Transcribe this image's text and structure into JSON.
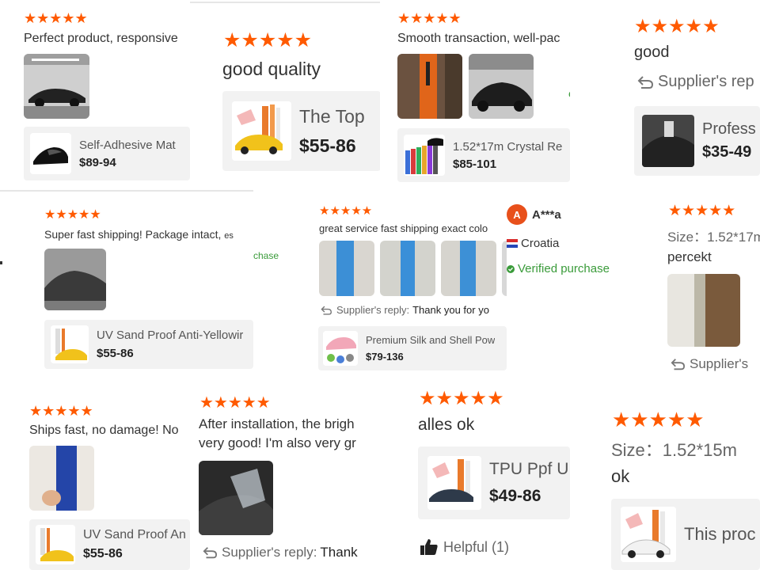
{
  "colors": {
    "star": "#ff5a00",
    "verified": "#3a9b3a",
    "card_bg": "#f2f2f2",
    "avatar": "#e8501b"
  },
  "icons": {
    "star": "★",
    "reply": "reply-arrow-icon",
    "verified": "check-badge-icon",
    "helpful": "thumbs-up-icon"
  },
  "reviews": {
    "r1": {
      "stars": "★★★★★",
      "text": "Perfect product, responsive",
      "product": {
        "name": "Self-Adhesive Mat",
        "price": "$89-94"
      }
    },
    "r2": {
      "stars": "★★★★★",
      "text": "good quality",
      "product": {
        "name": "The Top",
        "price": "$55-86"
      }
    },
    "r3": {
      "stars": "★★★★★",
      "text": "Smooth transaction, well-pac",
      "side": "e",
      "product": {
        "name": "1.52*17m Crystal Re",
        "price": "$85-101"
      }
    },
    "r4": {
      "stars": "★★★★★",
      "text": "good",
      "reply": "Supplier's rep",
      "product": {
        "name": "Profess",
        "price": "$35-49"
      }
    },
    "r5": {
      "stars": "★★★★★",
      "text": "Super fast shipping! Package intact,",
      "text_cut": "es",
      "side": "chase",
      "product": {
        "name": "UV Sand Proof Anti-Yellowir",
        "price": "$55-86"
      }
    },
    "r6": {
      "stars": "★★★★★",
      "text": "great service fast shipping exact colo",
      "reply_label": "Supplier's reply:",
      "reply_text": "Thank you for yo",
      "product": {
        "name": "Premium Silk and Shell Pow",
        "price": "$79-136"
      }
    },
    "r7": {
      "avatar": "A",
      "user": "A***a",
      "country": "Croatia",
      "verified": "Verified purchase"
    },
    "r8": {
      "stars": "★★★★★",
      "size": "Size：1.52*17m",
      "text": "percekt",
      "reply": "Supplier's"
    },
    "r9": {
      "stars": "★★★★★",
      "text": "Ships fast, no damage! No",
      "product": {
        "name": "UV Sand Proof An",
        "price": "$55-86"
      }
    },
    "r10": {
      "stars": "★★★★★",
      "line1": "After installation, the brigh",
      "line2": "very good! I'm also very gr",
      "reply_label": "Supplier's reply:",
      "reply_text": "Thank"
    },
    "r11": {
      "stars": "★★★★★",
      "text": "alles ok",
      "helpful": "Helpful (1)",
      "product": {
        "name": "TPU Ppf U",
        "price": "$49-86"
      }
    },
    "r12": {
      "stars": "★★★★★",
      "size": "Size：1.52*15m",
      "text": "ok",
      "product": {
        "name": "This proc"
      }
    }
  }
}
